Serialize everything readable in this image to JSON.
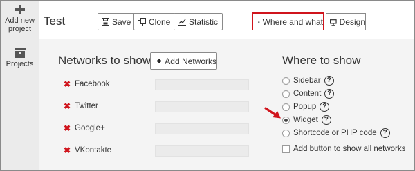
{
  "sidebar": {
    "items": [
      {
        "label": "Add new project",
        "icon": "plus-icon"
      },
      {
        "label": "Projects",
        "icon": "archive-icon"
      }
    ]
  },
  "header": {
    "title": "Test",
    "buttons": {
      "save": "Save",
      "clone": "Clone",
      "statistic": "Statistic"
    }
  },
  "tabs": [
    {
      "label": "Where and what",
      "icon": "home-icon",
      "active": true
    },
    {
      "label": "Design",
      "icon": "monitor-icon",
      "active": false
    }
  ],
  "networks": {
    "title": "Networks to show",
    "add_label": "Add Networks",
    "items": [
      {
        "name": "Facebook",
        "value": ""
      },
      {
        "name": "Twitter",
        "value": ""
      },
      {
        "name": "Google+",
        "value": ""
      },
      {
        "name": "VKontakte",
        "value": ""
      }
    ]
  },
  "where": {
    "title": "Where to show",
    "options": [
      {
        "label": "Sidebar",
        "checked": false
      },
      {
        "label": "Content",
        "checked": false
      },
      {
        "label": "Popup",
        "checked": false
      },
      {
        "label": "Widget",
        "checked": true
      },
      {
        "label": "Shortcode or PHP code",
        "checked": false
      }
    ],
    "help_glyph": "?",
    "checkbox_label": "Add button to show all networks",
    "checkbox_checked": false
  },
  "colors": {
    "accent_red": "#d0141c",
    "sidebar_bg": "#ebebeb",
    "panel_bg": "#f4f4f4"
  },
  "remove_glyph": "✖"
}
